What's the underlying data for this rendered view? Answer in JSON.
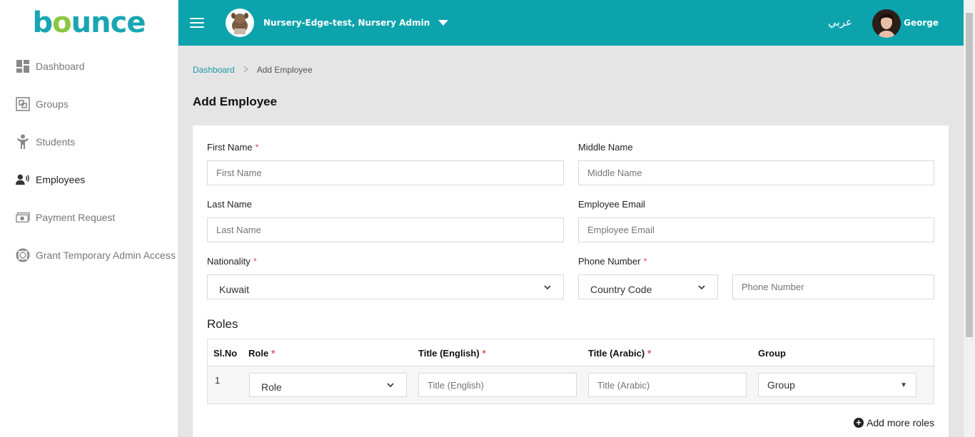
{
  "brand": {
    "logo_b": "b",
    "logo_o": "o",
    "logo_rest": "unce",
    "primary_color": "#0ca3ad",
    "logo_green": "#8cc63f"
  },
  "sidebar": {
    "items": [
      {
        "label": "Dashboard",
        "icon": "dashboard-icon"
      },
      {
        "label": "Groups",
        "icon": "groups-icon"
      },
      {
        "label": "Students",
        "icon": "students-icon"
      },
      {
        "label": "Employees",
        "icon": "employees-icon",
        "active": true
      },
      {
        "label": "Payment Request",
        "icon": "payment-icon"
      },
      {
        "label": "Grant Temporary Admin Access",
        "icon": "lifebuoy-icon"
      }
    ]
  },
  "header": {
    "org_name": "Nursery-Edge-test, Nursery Admin",
    "language_toggle": "عربي",
    "user_name": "George"
  },
  "breadcrumb": {
    "home": "Dashboard",
    "current": "Add Employee"
  },
  "page_title": "Add Employee",
  "form": {
    "first_name": {
      "label": "First Name",
      "required": "*",
      "placeholder": "First Name"
    },
    "middle_name": {
      "label": "Middle Name",
      "placeholder": "Middle Name"
    },
    "last_name": {
      "label": "Last Name",
      "placeholder": "Last Name"
    },
    "email": {
      "label": "Employee Email",
      "placeholder": "Employee Email"
    },
    "nationality": {
      "label": "Nationality",
      "required": "*",
      "value": "Kuwait"
    },
    "phone": {
      "label": "Phone Number",
      "required": "*",
      "country_code": "Country Code",
      "placeholder": "Phone Number"
    }
  },
  "roles": {
    "heading": "Roles",
    "columns": {
      "sl_no": "Sl.No",
      "role": "Role",
      "title_en": "Title (English)",
      "title_ar": "Title (Arabic)",
      "group": "Group"
    },
    "required": "*",
    "rows": [
      {
        "num": "1",
        "role": "Role",
        "title_en_placeholder": "Title (English)",
        "title_ar_placeholder": "Title (Arabic)",
        "group": "Group"
      }
    ],
    "add_more": "Add more roles"
  }
}
